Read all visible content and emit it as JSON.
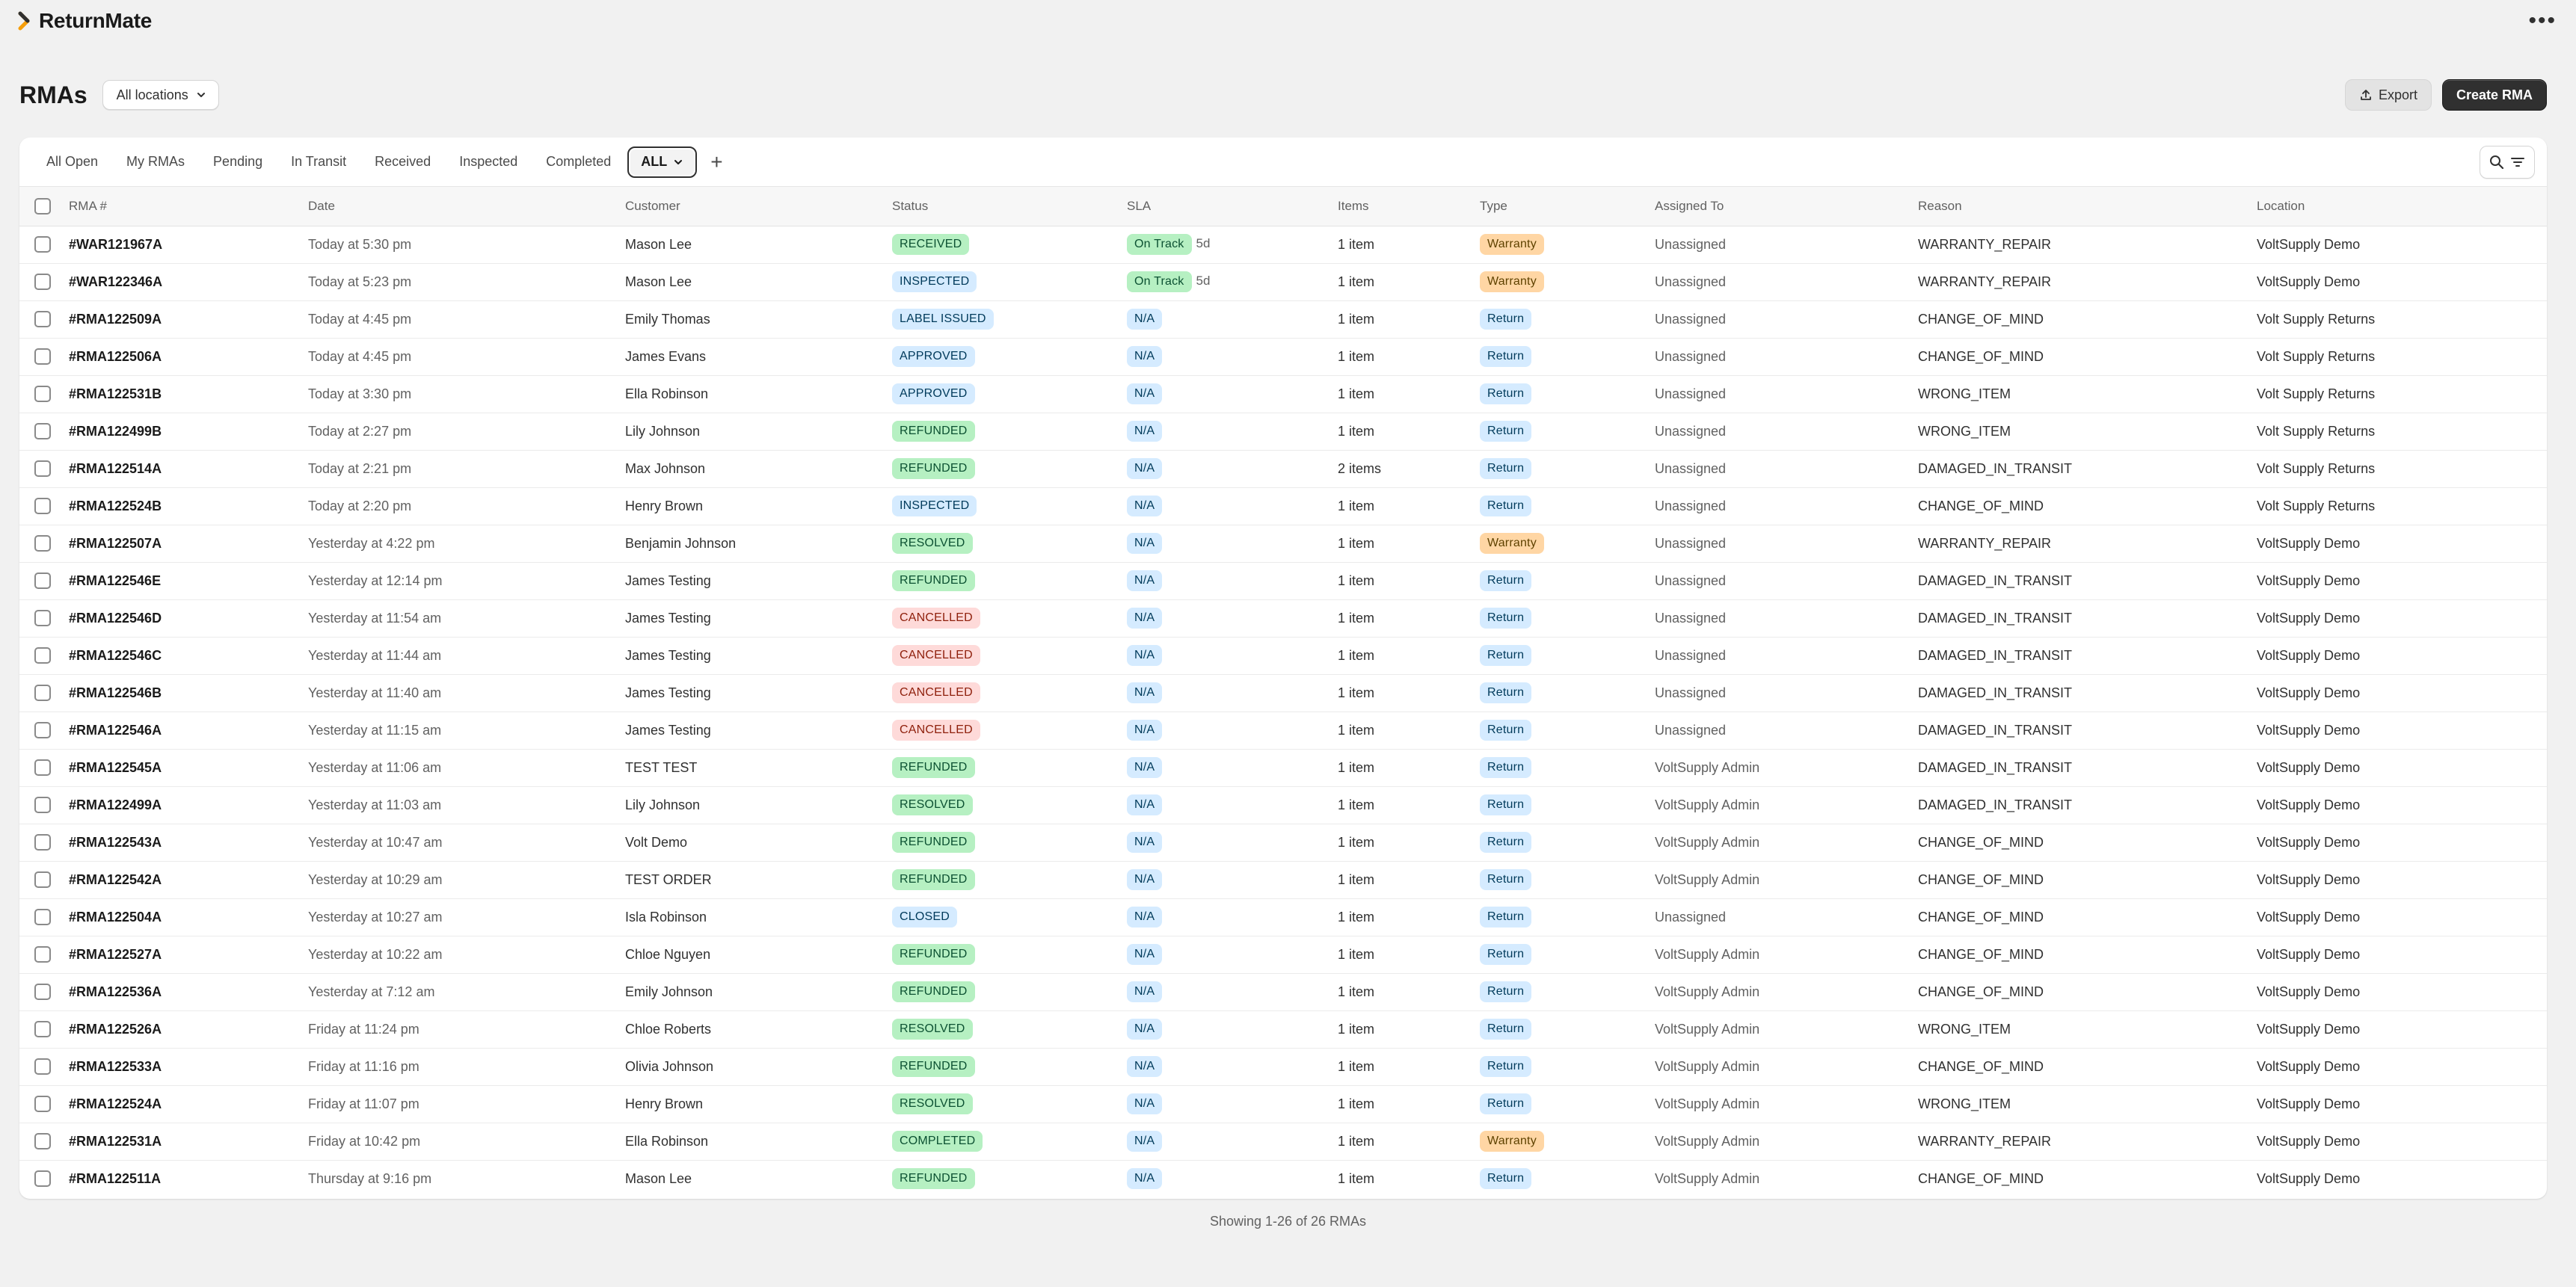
{
  "app": {
    "name": "ReturnMate",
    "brand_color": "#f59e0b"
  },
  "header": {
    "title": "RMAs",
    "location_select": "All locations",
    "export_label": "Export",
    "create_label": "Create RMA"
  },
  "tabs": [
    {
      "label": "All Open"
    },
    {
      "label": "My RMAs"
    },
    {
      "label": "Pending"
    },
    {
      "label": "In Transit"
    },
    {
      "label": "Received"
    },
    {
      "label": "Inspected"
    },
    {
      "label": "Completed"
    },
    {
      "label": "ALL",
      "active": true
    }
  ],
  "columns": [
    "RMA #",
    "Date",
    "Customer",
    "Status",
    "SLA",
    "Items",
    "Type",
    "Assigned To",
    "Reason",
    "Location"
  ],
  "rows": [
    {
      "id": "#WAR121967A",
      "date": "Today at 5:30 pm",
      "customer": "Mason Lee",
      "status": "RECEIVED",
      "status_color": "green",
      "sla": "On Track",
      "sla_days": "5d",
      "items": "1 item",
      "type": "Warranty",
      "assigned": "Unassigned",
      "reason": "WARRANTY_REPAIR",
      "location": "VoltSupply Demo"
    },
    {
      "id": "#WAR122346A",
      "date": "Today at 5:23 pm",
      "customer": "Mason Lee",
      "status": "INSPECTED",
      "status_color": "blue",
      "sla": "On Track",
      "sla_days": "5d",
      "items": "1 item",
      "type": "Warranty",
      "assigned": "Unassigned",
      "reason": "WARRANTY_REPAIR",
      "location": "VoltSupply Demo"
    },
    {
      "id": "#RMA122509A",
      "date": "Today at 4:45 pm",
      "customer": "Emily Thomas",
      "status": "LABEL ISSUED",
      "status_color": "blue",
      "sla": "N/A",
      "items": "1 item",
      "type": "Return",
      "assigned": "Unassigned",
      "reason": "CHANGE_OF_MIND",
      "location": "Volt Supply Returns"
    },
    {
      "id": "#RMA122506A",
      "date": "Today at 4:45 pm",
      "customer": "James Evans",
      "status": "APPROVED",
      "status_color": "blue",
      "sla": "N/A",
      "items": "1 item",
      "type": "Return",
      "assigned": "Unassigned",
      "reason": "CHANGE_OF_MIND",
      "location": "Volt Supply Returns"
    },
    {
      "id": "#RMA122531B",
      "date": "Today at 3:30 pm",
      "customer": "Ella Robinson",
      "status": "APPROVED",
      "status_color": "blue",
      "sla": "N/A",
      "items": "1 item",
      "type": "Return",
      "assigned": "Unassigned",
      "reason": "WRONG_ITEM",
      "location": "Volt Supply Returns"
    },
    {
      "id": "#RMA122499B",
      "date": "Today at 2:27 pm",
      "customer": "Lily Johnson",
      "status": "REFUNDED",
      "status_color": "green",
      "sla": "N/A",
      "items": "1 item",
      "type": "Return",
      "assigned": "Unassigned",
      "reason": "WRONG_ITEM",
      "location": "Volt Supply Returns"
    },
    {
      "id": "#RMA122514A",
      "date": "Today at 2:21 pm",
      "customer": "Max Johnson",
      "status": "REFUNDED",
      "status_color": "green",
      "sla": "N/A",
      "items": "2 items",
      "type": "Return",
      "assigned": "Unassigned",
      "reason": "DAMAGED_IN_TRANSIT",
      "location": "Volt Supply Returns"
    },
    {
      "id": "#RMA122524B",
      "date": "Today at 2:20 pm",
      "customer": "Henry Brown",
      "status": "INSPECTED",
      "status_color": "blue",
      "sla": "N/A",
      "items": "1 item",
      "type": "Return",
      "assigned": "Unassigned",
      "reason": "CHANGE_OF_MIND",
      "location": "Volt Supply Returns"
    },
    {
      "id": "#RMA122507A",
      "date": "Yesterday at 4:22 pm",
      "customer": "Benjamin Johnson",
      "status": "RESOLVED",
      "status_color": "green",
      "sla": "N/A",
      "items": "1 item",
      "type": "Warranty",
      "assigned": "Unassigned",
      "reason": "WARRANTY_REPAIR",
      "location": "VoltSupply Demo"
    },
    {
      "id": "#RMA122546E",
      "date": "Yesterday at 12:14 pm",
      "customer": "James Testing",
      "status": "REFUNDED",
      "status_color": "green",
      "sla": "N/A",
      "items": "1 item",
      "type": "Return",
      "assigned": "Unassigned",
      "reason": "DAMAGED_IN_TRANSIT",
      "location": "VoltSupply Demo"
    },
    {
      "id": "#RMA122546D",
      "date": "Yesterday at 11:54 am",
      "customer": "James Testing",
      "status": "CANCELLED",
      "status_color": "red",
      "sla": "N/A",
      "items": "1 item",
      "type": "Return",
      "assigned": "Unassigned",
      "reason": "DAMAGED_IN_TRANSIT",
      "location": "VoltSupply Demo"
    },
    {
      "id": "#RMA122546C",
      "date": "Yesterday at 11:44 am",
      "customer": "James Testing",
      "status": "CANCELLED",
      "status_color": "red",
      "sla": "N/A",
      "items": "1 item",
      "type": "Return",
      "assigned": "Unassigned",
      "reason": "DAMAGED_IN_TRANSIT",
      "location": "VoltSupply Demo"
    },
    {
      "id": "#RMA122546B",
      "date": "Yesterday at 11:40 am",
      "customer": "James Testing",
      "status": "CANCELLED",
      "status_color": "red",
      "sla": "N/A",
      "items": "1 item",
      "type": "Return",
      "assigned": "Unassigned",
      "reason": "DAMAGED_IN_TRANSIT",
      "location": "VoltSupply Demo"
    },
    {
      "id": "#RMA122546A",
      "date": "Yesterday at 11:15 am",
      "customer": "James Testing",
      "status": "CANCELLED",
      "status_color": "red",
      "sla": "N/A",
      "items": "1 item",
      "type": "Return",
      "assigned": "Unassigned",
      "reason": "DAMAGED_IN_TRANSIT",
      "location": "VoltSupply Demo"
    },
    {
      "id": "#RMA122545A",
      "date": "Yesterday at 11:06 am",
      "customer": "TEST TEST",
      "status": "REFUNDED",
      "status_color": "green",
      "sla": "N/A",
      "items": "1 item",
      "type": "Return",
      "assigned": "VoltSupply Admin",
      "reason": "DAMAGED_IN_TRANSIT",
      "location": "VoltSupply Demo"
    },
    {
      "id": "#RMA122499A",
      "date": "Yesterday at 11:03 am",
      "customer": "Lily Johnson",
      "status": "RESOLVED",
      "status_color": "green",
      "sla": "N/A",
      "items": "1 item",
      "type": "Return",
      "assigned": "VoltSupply Admin",
      "reason": "DAMAGED_IN_TRANSIT",
      "location": "VoltSupply Demo"
    },
    {
      "id": "#RMA122543A",
      "date": "Yesterday at 10:47 am",
      "customer": "Volt Demo",
      "status": "REFUNDED",
      "status_color": "green",
      "sla": "N/A",
      "items": "1 item",
      "type": "Return",
      "assigned": "VoltSupply Admin",
      "reason": "CHANGE_OF_MIND",
      "location": "VoltSupply Demo"
    },
    {
      "id": "#RMA122542A",
      "date": "Yesterday at 10:29 am",
      "customer": "TEST ORDER",
      "status": "REFUNDED",
      "status_color": "green",
      "sla": "N/A",
      "items": "1 item",
      "type": "Return",
      "assigned": "VoltSupply Admin",
      "reason": "CHANGE_OF_MIND",
      "location": "VoltSupply Demo"
    },
    {
      "id": "#RMA122504A",
      "date": "Yesterday at 10:27 am",
      "customer": "Isla Robinson",
      "status": "CLOSED",
      "status_color": "blue",
      "sla": "N/A",
      "items": "1 item",
      "type": "Return",
      "assigned": "Unassigned",
      "reason": "CHANGE_OF_MIND",
      "location": "VoltSupply Demo"
    },
    {
      "id": "#RMA122527A",
      "date": "Yesterday at 10:22 am",
      "customer": "Chloe Nguyen",
      "status": "REFUNDED",
      "status_color": "green",
      "sla": "N/A",
      "items": "1 item",
      "type": "Return",
      "assigned": "VoltSupply Admin",
      "reason": "CHANGE_OF_MIND",
      "location": "VoltSupply Demo"
    },
    {
      "id": "#RMA122536A",
      "date": "Yesterday at 7:12 am",
      "customer": "Emily Johnson",
      "status": "REFUNDED",
      "status_color": "green",
      "sla": "N/A",
      "items": "1 item",
      "type": "Return",
      "assigned": "VoltSupply Admin",
      "reason": "CHANGE_OF_MIND",
      "location": "VoltSupply Demo"
    },
    {
      "id": "#RMA122526A",
      "date": "Friday at 11:24 pm",
      "customer": "Chloe Roberts",
      "status": "RESOLVED",
      "status_color": "green",
      "sla": "N/A",
      "items": "1 item",
      "type": "Return",
      "assigned": "VoltSupply Admin",
      "reason": "WRONG_ITEM",
      "location": "VoltSupply Demo"
    },
    {
      "id": "#RMA122533A",
      "date": "Friday at 11:16 pm",
      "customer": "Olivia Johnson",
      "status": "REFUNDED",
      "status_color": "green",
      "sla": "N/A",
      "items": "1 item",
      "type": "Return",
      "assigned": "VoltSupply Admin",
      "reason": "CHANGE_OF_MIND",
      "location": "VoltSupply Demo"
    },
    {
      "id": "#RMA122524A",
      "date": "Friday at 11:07 pm",
      "customer": "Henry Brown",
      "status": "RESOLVED",
      "status_color": "green",
      "sla": "N/A",
      "items": "1 item",
      "type": "Return",
      "assigned": "VoltSupply Admin",
      "reason": "WRONG_ITEM",
      "location": "VoltSupply Demo"
    },
    {
      "id": "#RMA122531A",
      "date": "Friday at 10:42 pm",
      "customer": "Ella Robinson",
      "status": "COMPLETED",
      "status_color": "green",
      "sla": "N/A",
      "items": "1 item",
      "type": "Warranty",
      "assigned": "VoltSupply Admin",
      "reason": "WARRANTY_REPAIR",
      "location": "VoltSupply Demo"
    },
    {
      "id": "#RMA122511A",
      "date": "Thursday at 9:16 pm",
      "customer": "Mason Lee",
      "status": "REFUNDED",
      "status_color": "green",
      "sla": "N/A",
      "items": "1 item",
      "type": "Return",
      "assigned": "VoltSupply Admin",
      "reason": "CHANGE_OF_MIND",
      "location": "VoltSupply Demo"
    }
  ],
  "footer": {
    "summary": "Showing 1-26 of 26 RMAs"
  },
  "icons": {
    "brand": "chevron-right-logo-icon",
    "more": "kebab-menu-icon",
    "location_dropdown": "chevron-down-icon",
    "export": "upload-icon",
    "add_tab": "plus-icon",
    "search": "search-icon",
    "filter": "filter-icon"
  }
}
